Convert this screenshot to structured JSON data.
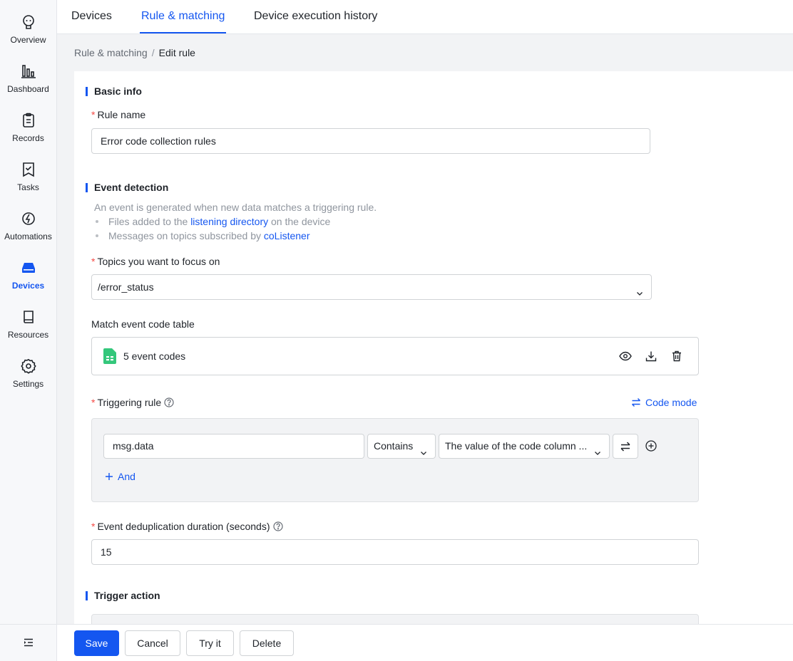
{
  "sidebar": {
    "items": [
      {
        "label": "Overview",
        "icon": "bot-icon"
      },
      {
        "label": "Dashboard",
        "icon": "bar-chart-icon"
      },
      {
        "label": "Records",
        "icon": "clipboard-icon"
      },
      {
        "label": "Tasks",
        "icon": "task-icon"
      },
      {
        "label": "Automations",
        "icon": "automation-icon"
      },
      {
        "label": "Devices",
        "icon": "device-icon"
      },
      {
        "label": "Resources",
        "icon": "book-icon"
      },
      {
        "label": "Settings",
        "icon": "gear-icon"
      }
    ],
    "active": "Devices",
    "collapse_icon": "collapse-menu-icon"
  },
  "tabs": [
    {
      "label": "Devices"
    },
    {
      "label": "Rule & matching"
    },
    {
      "label": "Device execution history"
    }
  ],
  "active_tab": "Rule & matching",
  "breadcrumb": {
    "parent": "Rule & matching",
    "separator": "/",
    "current": "Edit rule"
  },
  "basic_info": {
    "title": "Basic info",
    "rule_name_label": "Rule name",
    "rule_name_value": "Error code collection rules"
  },
  "event_detection": {
    "title": "Event detection",
    "description": "An event is generated when new data matches a triggering rule.",
    "bullet1_prefix": "Files added to the ",
    "bullet1_link": "listening directory",
    "bullet1_suffix": " on the device",
    "bullet2_prefix": "Messages on topics subscribed by ",
    "bullet2_link": "coListener",
    "topics_label": "Topics you want to focus on",
    "topics_value": "/error_status",
    "match_table_label": "Match event code table",
    "match_table_file": "5 event codes",
    "triggering_rule_label": "Triggering rule",
    "code_mode_label": "Code mode",
    "rule_field": "msg.data",
    "rule_operator": "Contains",
    "rule_value": "The value of the code column ...",
    "and_label": "And",
    "dedup_label": "Event deduplication duration (seconds)",
    "dedup_value": "15"
  },
  "trigger_action": {
    "title": "Trigger action"
  },
  "footer": {
    "save": "Save",
    "cancel": "Cancel",
    "try_it": "Try it",
    "delete": "Delete"
  },
  "colors": {
    "accent": "#1456f0",
    "required": "#f54a45",
    "sheet_icon": "#34c77b"
  }
}
